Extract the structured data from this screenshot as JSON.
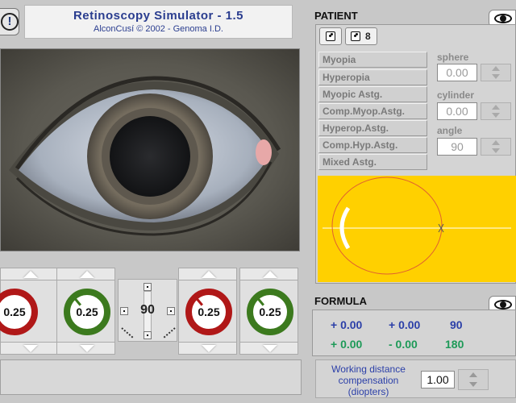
{
  "header": {
    "warning_glyph": "!",
    "title": "Retinoscopy Simulator - 1.5",
    "subtitle": "AlconCusí © 2002 - Genoma I.D."
  },
  "dials": [
    {
      "value": "0.25",
      "color": "#b01818"
    },
    {
      "value": "0.25",
      "color": "#3c7a1e"
    },
    {
      "value": "0.25",
      "color": "#b01818"
    },
    {
      "value": "0.25",
      "color": "#3c7a1e"
    }
  ],
  "axis": {
    "value": "90"
  },
  "patient": {
    "label": "PATIENT",
    "dice_count": "8",
    "cases": [
      "Myopia",
      "Hyperopia",
      "Myopic Astg.",
      "Comp.Myop.Astg.",
      "Hyperop.Astg.",
      "Comp.Hyp.Astg.",
      "Mixed Astg."
    ],
    "sphere_label": "sphere",
    "sphere_value": "0.00",
    "cylinder_label": "cylinder",
    "cylinder_value": "0.00",
    "angle_label": "angle",
    "angle_value": "90"
  },
  "formula": {
    "label": "FORMULA",
    "row1": [
      "+ 0.00",
      "+ 0.00",
      "90"
    ],
    "row2": [
      "+ 0.00",
      "- 0.00",
      "180"
    ]
  },
  "working_distance": {
    "label_line1": "Working distance",
    "label_line2": "compensation",
    "label_line3": "(diopters)",
    "value": "1.00"
  },
  "colors": {
    "title_blue": "#2a3d8f",
    "diagram_yellow": "#ffd000",
    "formula_blue": "#2b3fa8",
    "formula_green": "#1e9a58"
  }
}
